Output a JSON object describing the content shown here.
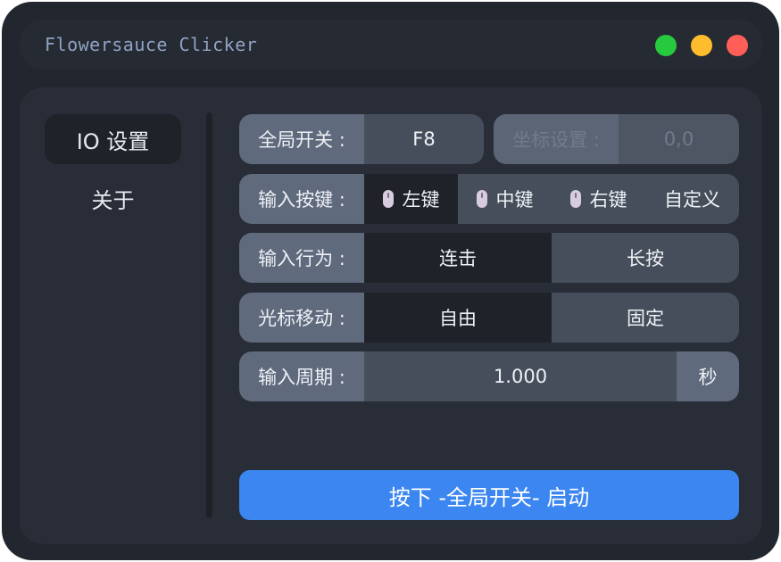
{
  "window": {
    "title": "Flowersauce Clicker",
    "controls": {
      "minimize": "green-dot",
      "maximize": "yellow-dot",
      "close": "red-dot"
    },
    "colors": {
      "green": "#27c93f",
      "yellow": "#ffbd2e",
      "red": "#ff5f56",
      "accent": "#3b86f0"
    }
  },
  "sidebar": {
    "items": [
      {
        "label": "IO 设置",
        "active": true
      },
      {
        "label": "关于",
        "active": false
      }
    ]
  },
  "settings": {
    "global_switch": {
      "label": "全局开关 :",
      "value": "F8"
    },
    "coord": {
      "label": "坐标设置 :",
      "value": "0,0",
      "disabled": true
    },
    "input_key": {
      "label": "输入按键 :",
      "options": [
        {
          "label": "左键",
          "icon": "mouse-icon",
          "selected": true
        },
        {
          "label": "中键",
          "icon": "mouse-icon",
          "selected": false
        },
        {
          "label": "右键",
          "icon": "mouse-icon",
          "selected": false
        },
        {
          "label": "自定义",
          "selected": false
        }
      ]
    },
    "input_behavior": {
      "label": "输入行为 :",
      "options": [
        {
          "label": "连击",
          "selected": true
        },
        {
          "label": "长按",
          "selected": false
        }
      ]
    },
    "cursor_move": {
      "label": "光标移动 :",
      "options": [
        {
          "label": "自由",
          "selected": true
        },
        {
          "label": "固定",
          "selected": false
        }
      ]
    },
    "input_period": {
      "label": "输入周期 :",
      "value": "1.000",
      "unit": "秒"
    }
  },
  "start_button": {
    "label": "按下 -全局开关- 启动"
  }
}
